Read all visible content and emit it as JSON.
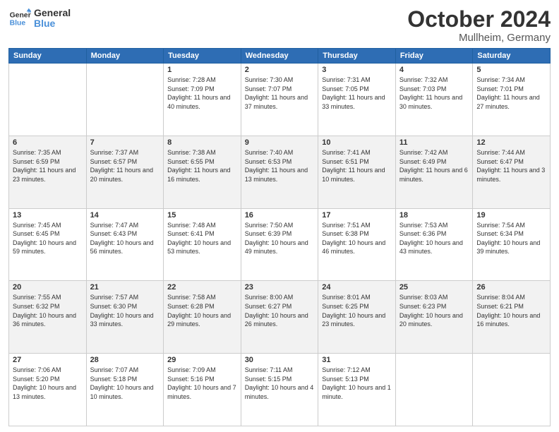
{
  "header": {
    "logo_line1": "General",
    "logo_line2": "Blue",
    "month_title": "October 2024",
    "subtitle": "Mullheim, Germany"
  },
  "days_of_week": [
    "Sunday",
    "Monday",
    "Tuesday",
    "Wednesday",
    "Thursday",
    "Friday",
    "Saturday"
  ],
  "weeks": [
    [
      {
        "day": "",
        "sunrise": "",
        "sunset": "",
        "daylight": ""
      },
      {
        "day": "",
        "sunrise": "",
        "sunset": "",
        "daylight": ""
      },
      {
        "day": "1",
        "sunrise": "Sunrise: 7:28 AM",
        "sunset": "Sunset: 7:09 PM",
        "daylight": "Daylight: 11 hours and 40 minutes."
      },
      {
        "day": "2",
        "sunrise": "Sunrise: 7:30 AM",
        "sunset": "Sunset: 7:07 PM",
        "daylight": "Daylight: 11 hours and 37 minutes."
      },
      {
        "day": "3",
        "sunrise": "Sunrise: 7:31 AM",
        "sunset": "Sunset: 7:05 PM",
        "daylight": "Daylight: 11 hours and 33 minutes."
      },
      {
        "day": "4",
        "sunrise": "Sunrise: 7:32 AM",
        "sunset": "Sunset: 7:03 PM",
        "daylight": "Daylight: 11 hours and 30 minutes."
      },
      {
        "day": "5",
        "sunrise": "Sunrise: 7:34 AM",
        "sunset": "Sunset: 7:01 PM",
        "daylight": "Daylight: 11 hours and 27 minutes."
      }
    ],
    [
      {
        "day": "6",
        "sunrise": "Sunrise: 7:35 AM",
        "sunset": "Sunset: 6:59 PM",
        "daylight": "Daylight: 11 hours and 23 minutes."
      },
      {
        "day": "7",
        "sunrise": "Sunrise: 7:37 AM",
        "sunset": "Sunset: 6:57 PM",
        "daylight": "Daylight: 11 hours and 20 minutes."
      },
      {
        "day": "8",
        "sunrise": "Sunrise: 7:38 AM",
        "sunset": "Sunset: 6:55 PM",
        "daylight": "Daylight: 11 hours and 16 minutes."
      },
      {
        "day": "9",
        "sunrise": "Sunrise: 7:40 AM",
        "sunset": "Sunset: 6:53 PM",
        "daylight": "Daylight: 11 hours and 13 minutes."
      },
      {
        "day": "10",
        "sunrise": "Sunrise: 7:41 AM",
        "sunset": "Sunset: 6:51 PM",
        "daylight": "Daylight: 11 hours and 10 minutes."
      },
      {
        "day": "11",
        "sunrise": "Sunrise: 7:42 AM",
        "sunset": "Sunset: 6:49 PM",
        "daylight": "Daylight: 11 hours and 6 minutes."
      },
      {
        "day": "12",
        "sunrise": "Sunrise: 7:44 AM",
        "sunset": "Sunset: 6:47 PM",
        "daylight": "Daylight: 11 hours and 3 minutes."
      }
    ],
    [
      {
        "day": "13",
        "sunrise": "Sunrise: 7:45 AM",
        "sunset": "Sunset: 6:45 PM",
        "daylight": "Daylight: 10 hours and 59 minutes."
      },
      {
        "day": "14",
        "sunrise": "Sunrise: 7:47 AM",
        "sunset": "Sunset: 6:43 PM",
        "daylight": "Daylight: 10 hours and 56 minutes."
      },
      {
        "day": "15",
        "sunrise": "Sunrise: 7:48 AM",
        "sunset": "Sunset: 6:41 PM",
        "daylight": "Daylight: 10 hours and 53 minutes."
      },
      {
        "day": "16",
        "sunrise": "Sunrise: 7:50 AM",
        "sunset": "Sunset: 6:39 PM",
        "daylight": "Daylight: 10 hours and 49 minutes."
      },
      {
        "day": "17",
        "sunrise": "Sunrise: 7:51 AM",
        "sunset": "Sunset: 6:38 PM",
        "daylight": "Daylight: 10 hours and 46 minutes."
      },
      {
        "day": "18",
        "sunrise": "Sunrise: 7:53 AM",
        "sunset": "Sunset: 6:36 PM",
        "daylight": "Daylight: 10 hours and 43 minutes."
      },
      {
        "day": "19",
        "sunrise": "Sunrise: 7:54 AM",
        "sunset": "Sunset: 6:34 PM",
        "daylight": "Daylight: 10 hours and 39 minutes."
      }
    ],
    [
      {
        "day": "20",
        "sunrise": "Sunrise: 7:55 AM",
        "sunset": "Sunset: 6:32 PM",
        "daylight": "Daylight: 10 hours and 36 minutes."
      },
      {
        "day": "21",
        "sunrise": "Sunrise: 7:57 AM",
        "sunset": "Sunset: 6:30 PM",
        "daylight": "Daylight: 10 hours and 33 minutes."
      },
      {
        "day": "22",
        "sunrise": "Sunrise: 7:58 AM",
        "sunset": "Sunset: 6:28 PM",
        "daylight": "Daylight: 10 hours and 29 minutes."
      },
      {
        "day": "23",
        "sunrise": "Sunrise: 8:00 AM",
        "sunset": "Sunset: 6:27 PM",
        "daylight": "Daylight: 10 hours and 26 minutes."
      },
      {
        "day": "24",
        "sunrise": "Sunrise: 8:01 AM",
        "sunset": "Sunset: 6:25 PM",
        "daylight": "Daylight: 10 hours and 23 minutes."
      },
      {
        "day": "25",
        "sunrise": "Sunrise: 8:03 AM",
        "sunset": "Sunset: 6:23 PM",
        "daylight": "Daylight: 10 hours and 20 minutes."
      },
      {
        "day": "26",
        "sunrise": "Sunrise: 8:04 AM",
        "sunset": "Sunset: 6:21 PM",
        "daylight": "Daylight: 10 hours and 16 minutes."
      }
    ],
    [
      {
        "day": "27",
        "sunrise": "Sunrise: 7:06 AM",
        "sunset": "Sunset: 5:20 PM",
        "daylight": "Daylight: 10 hours and 13 minutes."
      },
      {
        "day": "28",
        "sunrise": "Sunrise: 7:07 AM",
        "sunset": "Sunset: 5:18 PM",
        "daylight": "Daylight: 10 hours and 10 minutes."
      },
      {
        "day": "29",
        "sunrise": "Sunrise: 7:09 AM",
        "sunset": "Sunset: 5:16 PM",
        "daylight": "Daylight: 10 hours and 7 minutes."
      },
      {
        "day": "30",
        "sunrise": "Sunrise: 7:11 AM",
        "sunset": "Sunset: 5:15 PM",
        "daylight": "Daylight: 10 hours and 4 minutes."
      },
      {
        "day": "31",
        "sunrise": "Sunrise: 7:12 AM",
        "sunset": "Sunset: 5:13 PM",
        "daylight": "Daylight: 10 hours and 1 minute."
      },
      {
        "day": "",
        "sunrise": "",
        "sunset": "",
        "daylight": ""
      },
      {
        "day": "",
        "sunrise": "",
        "sunset": "",
        "daylight": ""
      }
    ]
  ]
}
